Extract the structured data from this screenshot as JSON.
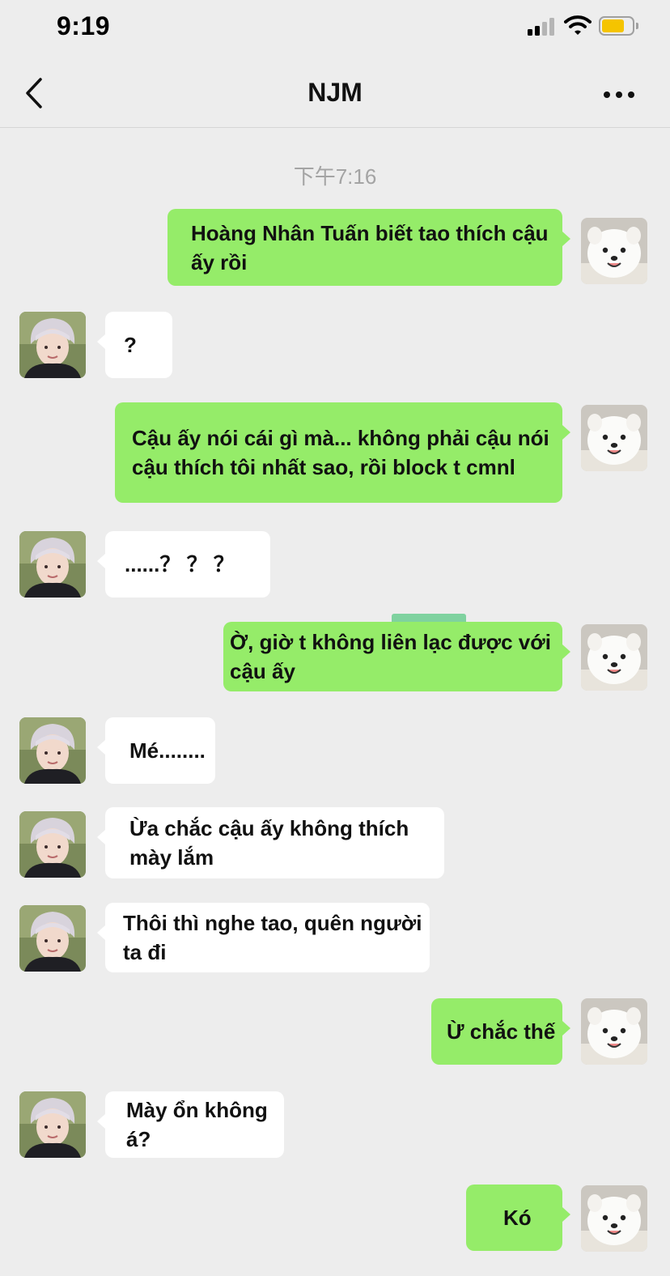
{
  "status_bar": {
    "time": "9:19",
    "icons": [
      "cellular-signal-icon",
      "wifi-icon",
      "battery-icon"
    ],
    "battery_level": 0.75,
    "battery_color": "#f5c400"
  },
  "nav": {
    "title": "NJM",
    "back_icon": "chevron-left-icon",
    "more_icon": "ellipsis-icon"
  },
  "chat": {
    "timestamp": "下午7:16",
    "colors": {
      "mine": "#95ec69",
      "theirs": "#ffffff",
      "background": "#ededed"
    },
    "messages": [
      {
        "sender": "me",
        "text": "Hoàng Nhân Tuấn biết tao thích cậu ấy rồi"
      },
      {
        "sender": "NJM",
        "text": "?"
      },
      {
        "sender": "me",
        "text": "Cậu ấy nói cái gì mà... không phải cậu nói cậu thích tôi nhất sao, rồi block t cmnl"
      },
      {
        "sender": "NJM",
        "text": "......？ ？ ？"
      },
      {
        "sender": "me",
        "text": "Ờ, giờ t không liên lạc được với cậu ấy"
      },
      {
        "sender": "NJM",
        "text": "Mé........"
      },
      {
        "sender": "NJM",
        "text": "Ừa chắc cậu ấy không thích mày lắm"
      },
      {
        "sender": "NJM",
        "text": "Thôi thì nghe tao, quên người ta đi"
      },
      {
        "sender": "me",
        "text": "Ừ chắc thế"
      },
      {
        "sender": "NJM",
        "text": "Mày ổn không á?"
      },
      {
        "sender": "me",
        "text": "Kó"
      }
    ]
  }
}
